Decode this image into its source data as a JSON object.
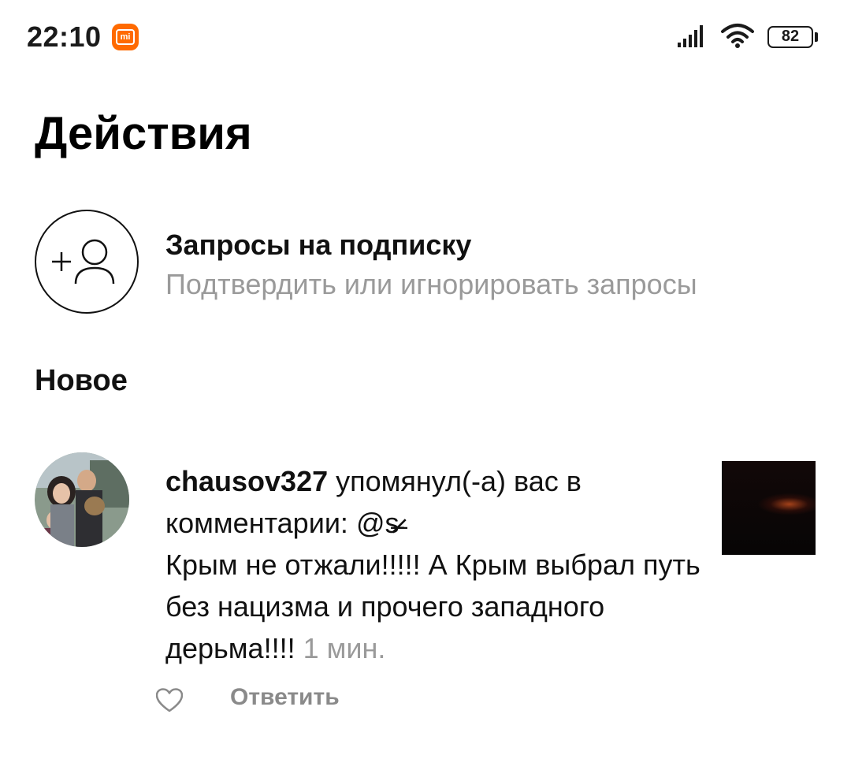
{
  "status_bar": {
    "time": "22:10",
    "battery": "82",
    "icons": [
      "mi-app-icon",
      "signal-icon",
      "wifi-icon",
      "battery-icon"
    ]
  },
  "header": {
    "title": "Действия"
  },
  "follow_requests": {
    "title": "Запросы на подписку",
    "subtitle": "Подтвердить или игнорировать запросы",
    "icon": "add-person-icon"
  },
  "section": {
    "new_label": "Новое"
  },
  "notification": {
    "username": "chausov327",
    "action": " упомянул(-а) вас в комментарии: ",
    "mention": "@s̷̵̶̷̵",
    "comment": "Крым не отжали!!!!! А Крым выбрал путь без нацизма и прочего западного дерьма!!!!",
    "time": "1 мин.",
    "reply_label": "Ответить",
    "like_icon": "heart-outline-icon"
  },
  "colors": {
    "text": "#111111",
    "secondary_text": "#9a9a9a",
    "mi_orange": "#ff6a00"
  }
}
